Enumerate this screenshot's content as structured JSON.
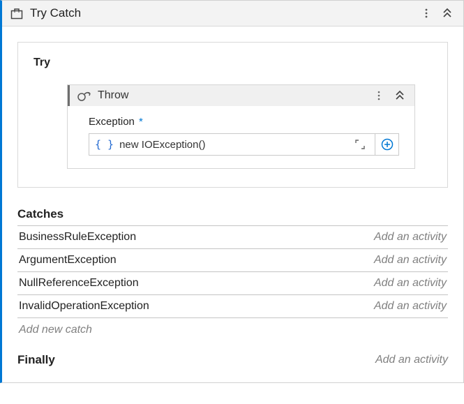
{
  "header": {
    "title": "Try Catch"
  },
  "try_section": {
    "label": "Try",
    "throw": {
      "title": "Throw",
      "field_label": "Exception",
      "required_mark": "*",
      "value": "new IOException()"
    }
  },
  "catches": {
    "heading": "Catches",
    "items": [
      {
        "type": "BusinessRuleException",
        "action": "Add an activity"
      },
      {
        "type": "ArgumentException",
        "action": "Add an activity"
      },
      {
        "type": "NullReferenceException",
        "action": "Add an activity"
      },
      {
        "type": "InvalidOperationException",
        "action": "Add an activity"
      }
    ],
    "add_new": "Add new catch"
  },
  "finally": {
    "label": "Finally",
    "action": "Add an activity"
  }
}
